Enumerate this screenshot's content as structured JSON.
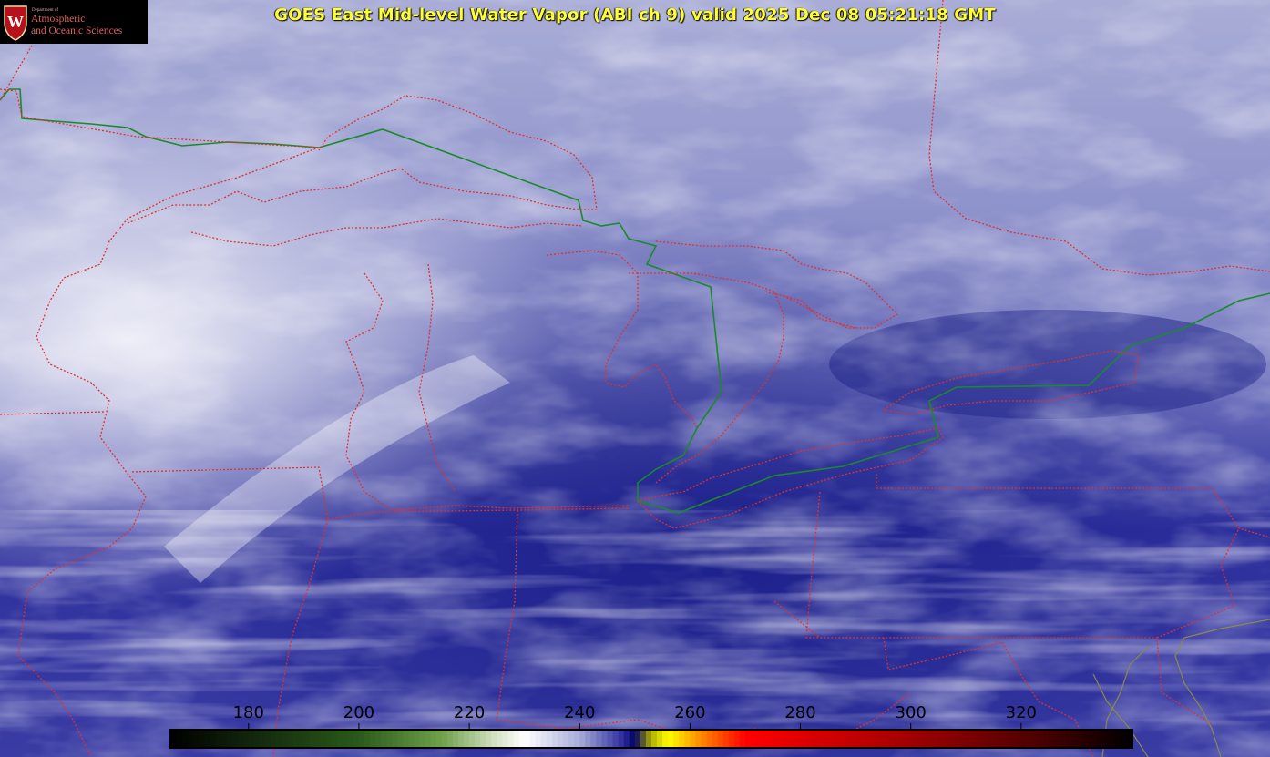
{
  "title": "GOES East Mid-level Water Vapor (ABI ch 9)  valid 2025 Dec 08 05:21:18 GMT",
  "logo": {
    "department": "Department of",
    "line1": "Atmospheric",
    "line2": "and Oceanic Sciences",
    "shield_letter": "W"
  },
  "colorbar": {
    "ticks": [
      180,
      200,
      220,
      240,
      260,
      280,
      300,
      320
    ],
    "min": 166,
    "max": 340,
    "stops": [
      {
        "value": 166,
        "color": "#000000"
      },
      {
        "value": 200,
        "color": "#2a5a1a"
      },
      {
        "value": 215,
        "color": "#6fa04a"
      },
      {
        "value": 225,
        "color": "#d6e4c8"
      },
      {
        "value": 230,
        "color": "#ffffff"
      },
      {
        "value": 240,
        "color": "#a8acd8"
      },
      {
        "value": 248,
        "color": "#2a2a9c"
      },
      {
        "value": 250,
        "color": "#000060"
      },
      {
        "value": 253,
        "color": "#b0b000"
      },
      {
        "value": 256,
        "color": "#ffff00"
      },
      {
        "value": 262,
        "color": "#ff8800"
      },
      {
        "value": 270,
        "color": "#ff0000"
      },
      {
        "value": 300,
        "color": "#a00000"
      },
      {
        "value": 322,
        "color": "#500000"
      },
      {
        "value": 340,
        "color": "#000000"
      }
    ]
  },
  "colors": {
    "state_borders": "#e03030",
    "country_border": "#1a8a2a",
    "title": "#ffff33"
  }
}
